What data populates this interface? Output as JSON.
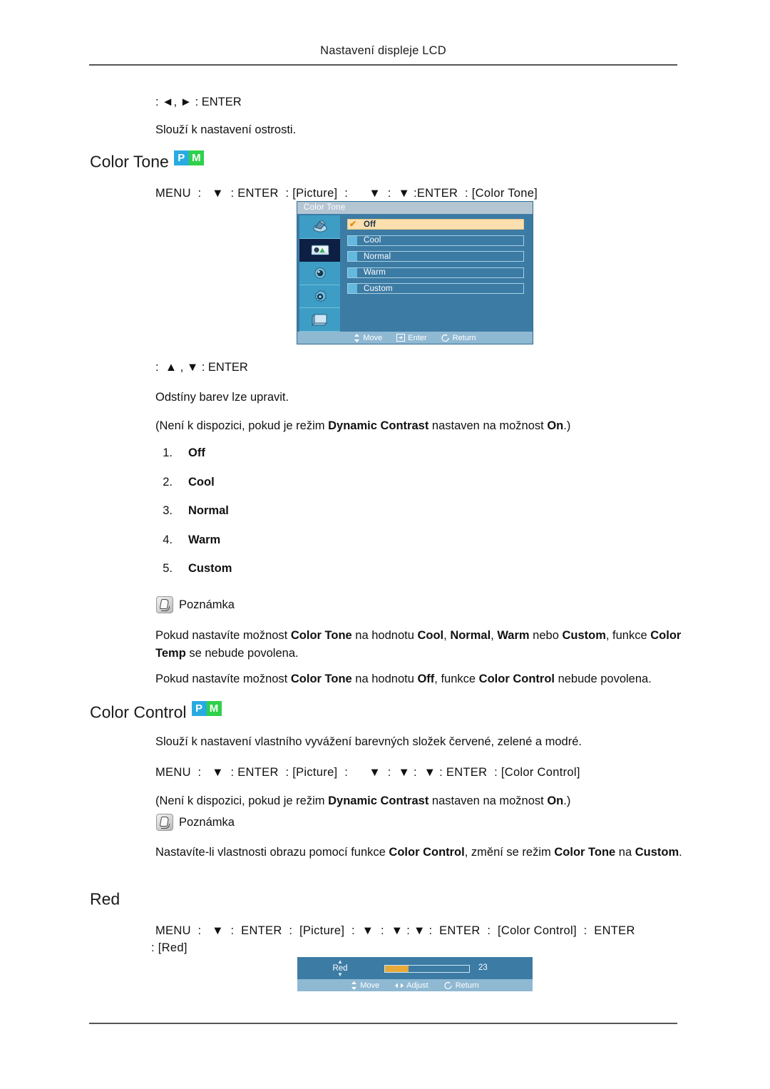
{
  "header": {
    "title": "Nastavení displeje LCD"
  },
  "top_block": {
    "key_line": ": ◄, ► : ENTER",
    "description": "Slouží k nastavení ostrosti."
  },
  "color_tone": {
    "heading": "Color Tone",
    "badges": [
      {
        "letter": "P",
        "color": "#29abe2"
      },
      {
        "letter": "M",
        "color": "#2fd14a"
      }
    ],
    "menu_path": "MENU  :   ▼  : ENTER  : [Picture]  :      ▼  :  ▼ :ENTER  : [Color Tone]",
    "key_line": ":  ▲ , ▼ : ENTER",
    "description": "Odstíny barev lze upravit.",
    "availability_note": "(Není k dispozici, pokud je režim Dynamic Contrast nastaven na možnost On.)",
    "availability_note_parts": [
      {
        "text": "(Není k dispozici, pokud je režim ",
        "bold": false
      },
      {
        "text": "Dynamic Contrast",
        "bold": true
      },
      {
        "text": " nastaven na možnost ",
        "bold": false
      },
      {
        "text": "On",
        "bold": true
      },
      {
        "text": ".)",
        "bold": false
      }
    ],
    "options": [
      {
        "num": "1.",
        "label": "Off"
      },
      {
        "num": "2.",
        "label": "Cool"
      },
      {
        "num": "3.",
        "label": "Normal"
      },
      {
        "num": "4.",
        "label": "Warm"
      },
      {
        "num": "5.",
        "label": "Custom"
      }
    ],
    "note_label": "Poznámka",
    "note_paragraph_1": "Pokud nastavíte možnost Color Tone na hodnotu Cool, Normal, Warm nebo Custom, funkce Color Temp se nebude povolena.",
    "note_paragraph_2": "Pokud nastavíte možnost Color Tone na hodnotu Off, funkce Color Control nebude povolena."
  },
  "osd_color_tone": {
    "title": "Color Tone",
    "items": [
      {
        "label": "Off",
        "selected": true
      },
      {
        "label": "Cool",
        "selected": false
      },
      {
        "label": "Normal",
        "selected": false
      },
      {
        "label": "Warm",
        "selected": false
      },
      {
        "label": "Custom",
        "selected": false
      }
    ],
    "sidebar_icons": [
      {
        "name": "input-source-icon",
        "selected": false
      },
      {
        "name": "picture-icon",
        "selected": true
      },
      {
        "name": "sound-icon",
        "selected": false
      },
      {
        "name": "setup-icon",
        "selected": false
      },
      {
        "name": "multi-control-icon",
        "selected": false
      }
    ],
    "footer": {
      "move": "Move",
      "enter": "Enter",
      "return": "Return"
    },
    "colors": {
      "body": "#3c7ba4",
      "titlebar": "#b5c6d3",
      "footer": "#8fb8d2",
      "highlight": "#fbdfae",
      "icon_tile": "#3e9dc4",
      "icon_tile_selected": "#0d1f42"
    }
  },
  "color_control": {
    "heading": "Color Control",
    "badges": [
      {
        "letter": "P",
        "color": "#29abe2"
      },
      {
        "letter": "M",
        "color": "#2fd14a"
      }
    ],
    "description": "Slouží k nastavení vlastního vyvážení barevných složek červené, zelené a modré.",
    "menu_path": "MENU  :   ▼  : ENTER  : [Picture]  :      ▼  :  ▼ :  ▼ : ENTER  : [Color Control]",
    "availability_note": "(Není k dispozici, pokud je režim Dynamic Contrast nastaven na možnost On.)",
    "note_label": "Poznámka",
    "note_paragraph": "Nastavíte-li vlastnosti obrazu pomocí funkce Color Control, změní se režim Color Tone na Custom."
  },
  "red": {
    "heading": "Red",
    "menu_path_line1": "MENU  :   ▼  :  ENTER  :  [Picture]  :  ▼  :  ▼ : ▼ :  ENTER  :  [Color Control]  :  ENTER",
    "menu_path_line2": ": [Red]"
  },
  "osd_red": {
    "label": "Red",
    "value": "23",
    "fill_percent": 28,
    "footer": {
      "move": "Move",
      "adjust": "Adjust",
      "return": "Return"
    },
    "colors": {
      "body": "#3c7ba4",
      "footer": "#8fb8d2",
      "fill": "#e8a93a"
    }
  }
}
